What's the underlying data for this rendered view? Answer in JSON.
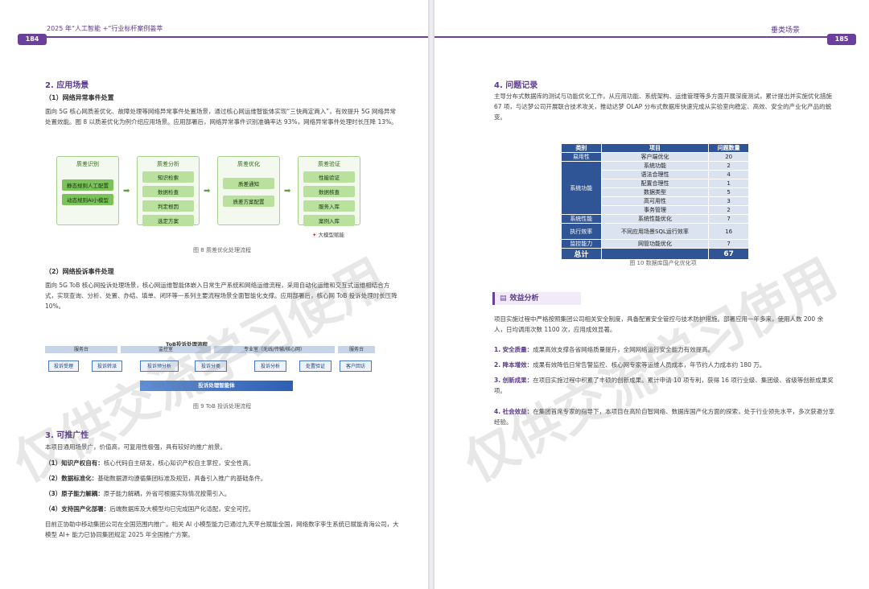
{
  "left": {
    "header_title": "2025 年“人工智能 +”行业标杆案例荟萃",
    "page_number": "184",
    "section2_title": "2. 应用场景",
    "sub1_title": "（1）网络异常事件处置",
    "sub1_text": "面向 5G 核心网质差优化、故障处理等网络异常事件处置场景，通过核心网运维智能体实现“三快两定两入”，有效提升 5G 网络异常处置效能。图 8 以质差优化为例介绍应用场景。应用部署后，网络异常事件识别准确率达 93%，网络异常事件处理时长压降 13%。",
    "fig8": {
      "stages": [
        {
          "title": "质差识别",
          "boxes": [
            "静态规则人工配置",
            "动态规则AI小模型"
          ]
        },
        {
          "title": "质差分析",
          "boxes": [
            "知识检索",
            "数据检查",
            "判定根因",
            "选定方案"
          ]
        },
        {
          "title": "质差优化",
          "boxes": [
            "质差通知",
            "质差方案配置"
          ]
        },
        {
          "title": "质差验证",
          "boxes": [
            "性能验证",
            "数据核查",
            "服务入库",
            "案例入库"
          ]
        }
      ],
      "legend": "大模型赋能",
      "caption": "图 8  质差优化处理流程"
    },
    "sub2_title": "（2）网络投诉事件处理",
    "sub2_text": "面向 5G ToB 核心网投诉处理场景，核心网运维智能体嵌入日常生产系统和网络运维流程，采用自动化运维和交互式运维相结合方式，实现查询、分析、处置、办结、填单、闭环等一系列主要流程场景全面智能化支撑。应用部署后，核心网 ToB 投诉处理时长压降 10%。",
    "fig9": {
      "title": "ToB投诉处理流程",
      "lanes": [
        "服务台",
        "监控室",
        "专业室（无线/传输/核心网）",
        "服务台"
      ],
      "steps": [
        "投诉受理",
        "投诉转派",
        "投诉预分析",
        "投诉分类",
        "投诉分析",
        "处置验证",
        "客户回访"
      ],
      "core": "投诉处理智能体",
      "caption": "图 9  ToB 投诉处理流程"
    },
    "section3_title": "3. 可推广性",
    "section3_intro": "本项目通用场景广，价值高，可复用性极强，具有较好的推广前景。",
    "items": [
      {
        "label": "（1）知识产权自有：",
        "text": "核心代码自主研发，核心知识产权自主掌控，安全性高。"
      },
      {
        "label": "（2）数据标准化：",
        "text": "基础数据源均遵循集团标准及规范，具备引入推广的基础条件。"
      },
      {
        "label": "（3）原子能力解耦：",
        "text": "原子能力解耦，外省可根据实际情况按需引入。"
      },
      {
        "label": "（4）支持国产化部署：",
        "text": "后端数据库及大模型均已完成国产化适配，安全可控。"
      }
    ],
    "closing": "目前正协助中移动集团公司在全国范围内推广。相关 AI 小模型能力已通过九天平台赋能全国，网络数字孪生系统已赋能青海公司，大模型 AI+ 能力已协同集团规定 2025 年全国推广方案。"
  },
  "right": {
    "header_title": "垂类场景",
    "page_number": "185",
    "section4_title": "4. 问题记录",
    "section4_text": "主导分布式数据库的测试与功能优化工作，从应用功能、系统架构、运维管理等多方面开展深度测试，累计提出并实施优化措施 67 项，与达梦公司开展联合技术攻关，推动达梦 OLAP 分布式数据库快速完成从实验室向稳定、高效、安全的产业化产品的蜕变。",
    "table": {
      "headers": [
        "类别",
        "项目",
        "问题数量"
      ],
      "rows": [
        {
          "cat": "易用性",
          "item": "客户端优化",
          "num": "20"
        },
        {
          "cat": "系统功能",
          "item": "系统功能",
          "num": "2"
        },
        {
          "cat": "",
          "item": "语法合理性",
          "num": "4"
        },
        {
          "cat": "",
          "item": "配置合理性",
          "num": "1"
        },
        {
          "cat": "",
          "item": "数据类型",
          "num": "5"
        },
        {
          "cat": "",
          "item": "高可用性",
          "num": "3"
        },
        {
          "cat": "",
          "item": "事务管理",
          "num": "2"
        },
        {
          "cat": "系统性能",
          "item": "系统性能优化",
          "num": "7"
        },
        {
          "cat": "执行效率",
          "item": "不同应用场景SQL运行效率",
          "num": "16"
        },
        {
          "cat": "监控能力",
          "item": "网管功能优化",
          "num": "7"
        }
      ],
      "total_label": "总计",
      "total_value": "67",
      "caption": "图 10  数据库国产化优化项"
    },
    "benefit_title": "效益分析",
    "benefit_intro": "项目实施过程中严格按照集团公司相关安全制度，具备配置安全管控与技术防护措施。部署应用一年多来，使用人数 200 余人，日均调用次数 1100 次，应用成效显著。",
    "benefits": [
      {
        "label": "1. 安全质量：",
        "text": "成果高效支撑各省网络质量提升，全网网络运行安全能力有效提高。"
      },
      {
        "label": "2. 降本增效：",
        "text": "成果有效降低日常告警监控、核心网专家等运维人员成本，年节约人力成本约 180 万。"
      },
      {
        "label": "3. 创新成果：",
        "text": "在项目实施过程中积累了丰硕的创新成果。累计申请 10 项专利，获得 16 项行业级、集团级、省级等创新成果奖项。"
      },
      {
        "label": "4. 社会效益：",
        "text": "在集团首席专家的指导下，本项目在高阶自智网络、数据库国产化方面的探索，处于行业领先水平，多次获邀分享经验。"
      }
    ]
  },
  "watermark": "仅供交流学习使用"
}
